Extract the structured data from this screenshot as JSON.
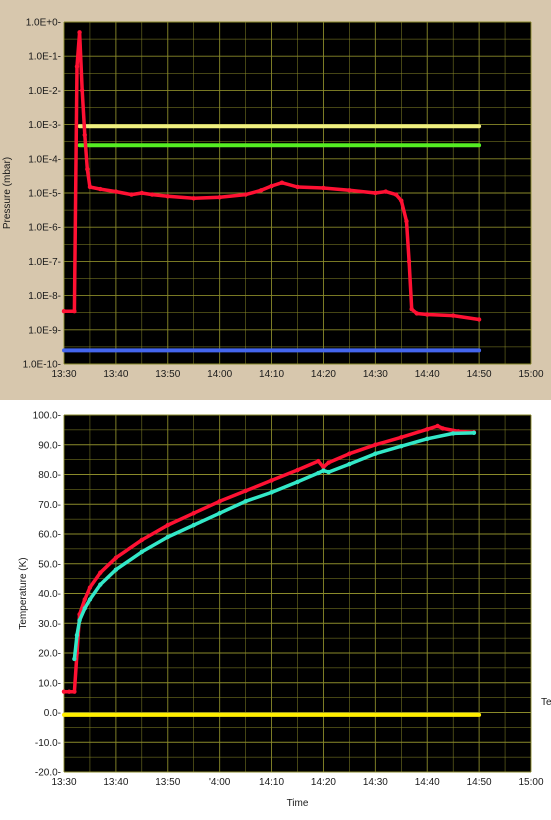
{
  "chart_data": [
    {
      "type": "line",
      "title": "",
      "xlabel": "",
      "ylabel": "Pressure (mbar)",
      "yscale": "log",
      "ylim": [
        1e-10,
        1
      ],
      "xlim": [
        "13:30",
        "15:00"
      ],
      "plot_background": "#000000",
      "grid": true,
      "grid_color": "#8a8a2a",
      "x_ticks": [
        "13:30",
        "13:40",
        "13:50",
        "14:00",
        "14:10",
        "14:20",
        "14:30",
        "14:40",
        "14:50",
        "15:00"
      ],
      "y_ticks": [
        "1.0E+0-",
        "1.0E-1-",
        "1.0E-2-",
        "1.0E-3-",
        "1.0E-4-",
        "1.0E-5-",
        "1.0E-6-",
        "1.0E-7-",
        "1.0E-8-",
        "1.0E-9-",
        "1.0E-10-"
      ],
      "series": [
        {
          "color": "#f0f080",
          "x": [
            "13:33",
            "14:50"
          ],
          "y": [
            0.0009,
            0.0009
          ]
        },
        {
          "color": "#55ee22",
          "x": [
            "13:33",
            "14:50"
          ],
          "y": [
            0.00025,
            0.00025
          ]
        },
        {
          "color": "#4466ee",
          "x": [
            "13:30",
            "14:50"
          ],
          "y": [
            2.5e-10,
            2.5e-10
          ]
        },
        {
          "color": "#ff1133",
          "x": [
            "13:30",
            "13:32",
            "13:32.5",
            "13:33",
            "13:33.5",
            "13:34",
            "13:34.5",
            "13:35",
            "13:37",
            "13:40",
            "13:43",
            "13:45",
            "13:47",
            "13:50",
            "13:55",
            "14:00",
            "14:05",
            "14:08",
            "14:10",
            "14:12",
            "14:15",
            "14:20",
            "14:25",
            "14:30",
            "14:32",
            "14:34",
            "14:35",
            "14:36",
            "14:36.5",
            "14:37",
            "14:38",
            "14:40",
            "14:45",
            "14:50"
          ],
          "y": [
            3.5e-09,
            3.5e-09,
            0.05,
            0.5,
            0.01,
            0.0005,
            5e-05,
            1.5e-05,
            1.3e-05,
            1.1e-05,
            9e-06,
            1e-05,
            9e-06,
            8e-06,
            7e-06,
            7.5e-06,
            9e-06,
            1.2e-05,
            1.6e-05,
            2e-05,
            1.5e-05,
            1.4e-05,
            1.2e-05,
            1e-05,
            1.1e-05,
            9e-06,
            6e-06,
            1.5e-06,
            1e-07,
            4e-09,
            3e-09,
            2.8e-09,
            2.6e-09,
            2e-09
          ]
        }
      ]
    },
    {
      "type": "line",
      "title": "",
      "xlabel": "Time",
      "ylabel": "Temperature (K)",
      "ylim": [
        -20,
        100
      ],
      "xlim": [
        "13:30",
        "15:00"
      ],
      "plot_background": "#000000",
      "grid": true,
      "grid_color": "#8a8a2a",
      "x_ticks": [
        "13:30",
        "13:40",
        "13:50",
        "'4:00",
        "14:10",
        "14:20",
        "14:30",
        "14:40",
        "14:50",
        "15:00"
      ],
      "y_ticks": [
        "100.0-",
        "90.0-",
        "80.0-",
        "70.0-",
        "60.0-",
        "50.0-",
        "40.0-",
        "30.0-",
        "20.0-",
        "10.0-",
        "0.0-",
        "-10.0-",
        "-20.0-"
      ],
      "edge_label": "Te",
      "series": [
        {
          "color": "#ff1133",
          "x": [
            "13:30",
            "13:31",
            "13:32",
            "13:32.5",
            "13:33",
            "13:34",
            "13:35",
            "13:37",
            "13:40",
            "13:45",
            "13:50",
            "13:55",
            "14:00",
            "14:05",
            "14:10",
            "14:15",
            "14:19",
            "14:20",
            "14:21",
            "14:25",
            "14:30",
            "14:35",
            "14:40",
            "14:42",
            "14:43",
            "14:46",
            "14:49"
          ],
          "y": [
            7,
            7,
            7,
            20,
            33,
            38,
            42,
            47,
            52,
            58,
            63,
            67,
            71,
            74.5,
            78,
            81.5,
            84.5,
            82.5,
            84,
            87,
            90,
            92.5,
            95.2,
            96.3,
            95.5,
            94.5,
            94.2
          ]
        },
        {
          "color": "#33e8c8",
          "x": [
            "13:32",
            "13:32.5",
            "13:33",
            "13:34",
            "13:35",
            "13:37",
            "13:40",
            "13:45",
            "13:50",
            "13:55",
            "14:00",
            "14:05",
            "14:10",
            "14:15",
            "14:19",
            "14:20",
            "14:21",
            "14:25",
            "14:30",
            "14:35",
            "14:40",
            "14:45",
            "14:49"
          ],
          "y": [
            18,
            26,
            31,
            35,
            38,
            43,
            48,
            54,
            59,
            63,
            67,
            71,
            74,
            77.5,
            80.5,
            81.3,
            80.8,
            83.5,
            87,
            89.5,
            92,
            93.8,
            94
          ]
        },
        {
          "color": "#ffee00",
          "x": [
            "13:30",
            "14:50"
          ],
          "y": [
            -0.8,
            -0.8
          ]
        }
      ]
    }
  ]
}
